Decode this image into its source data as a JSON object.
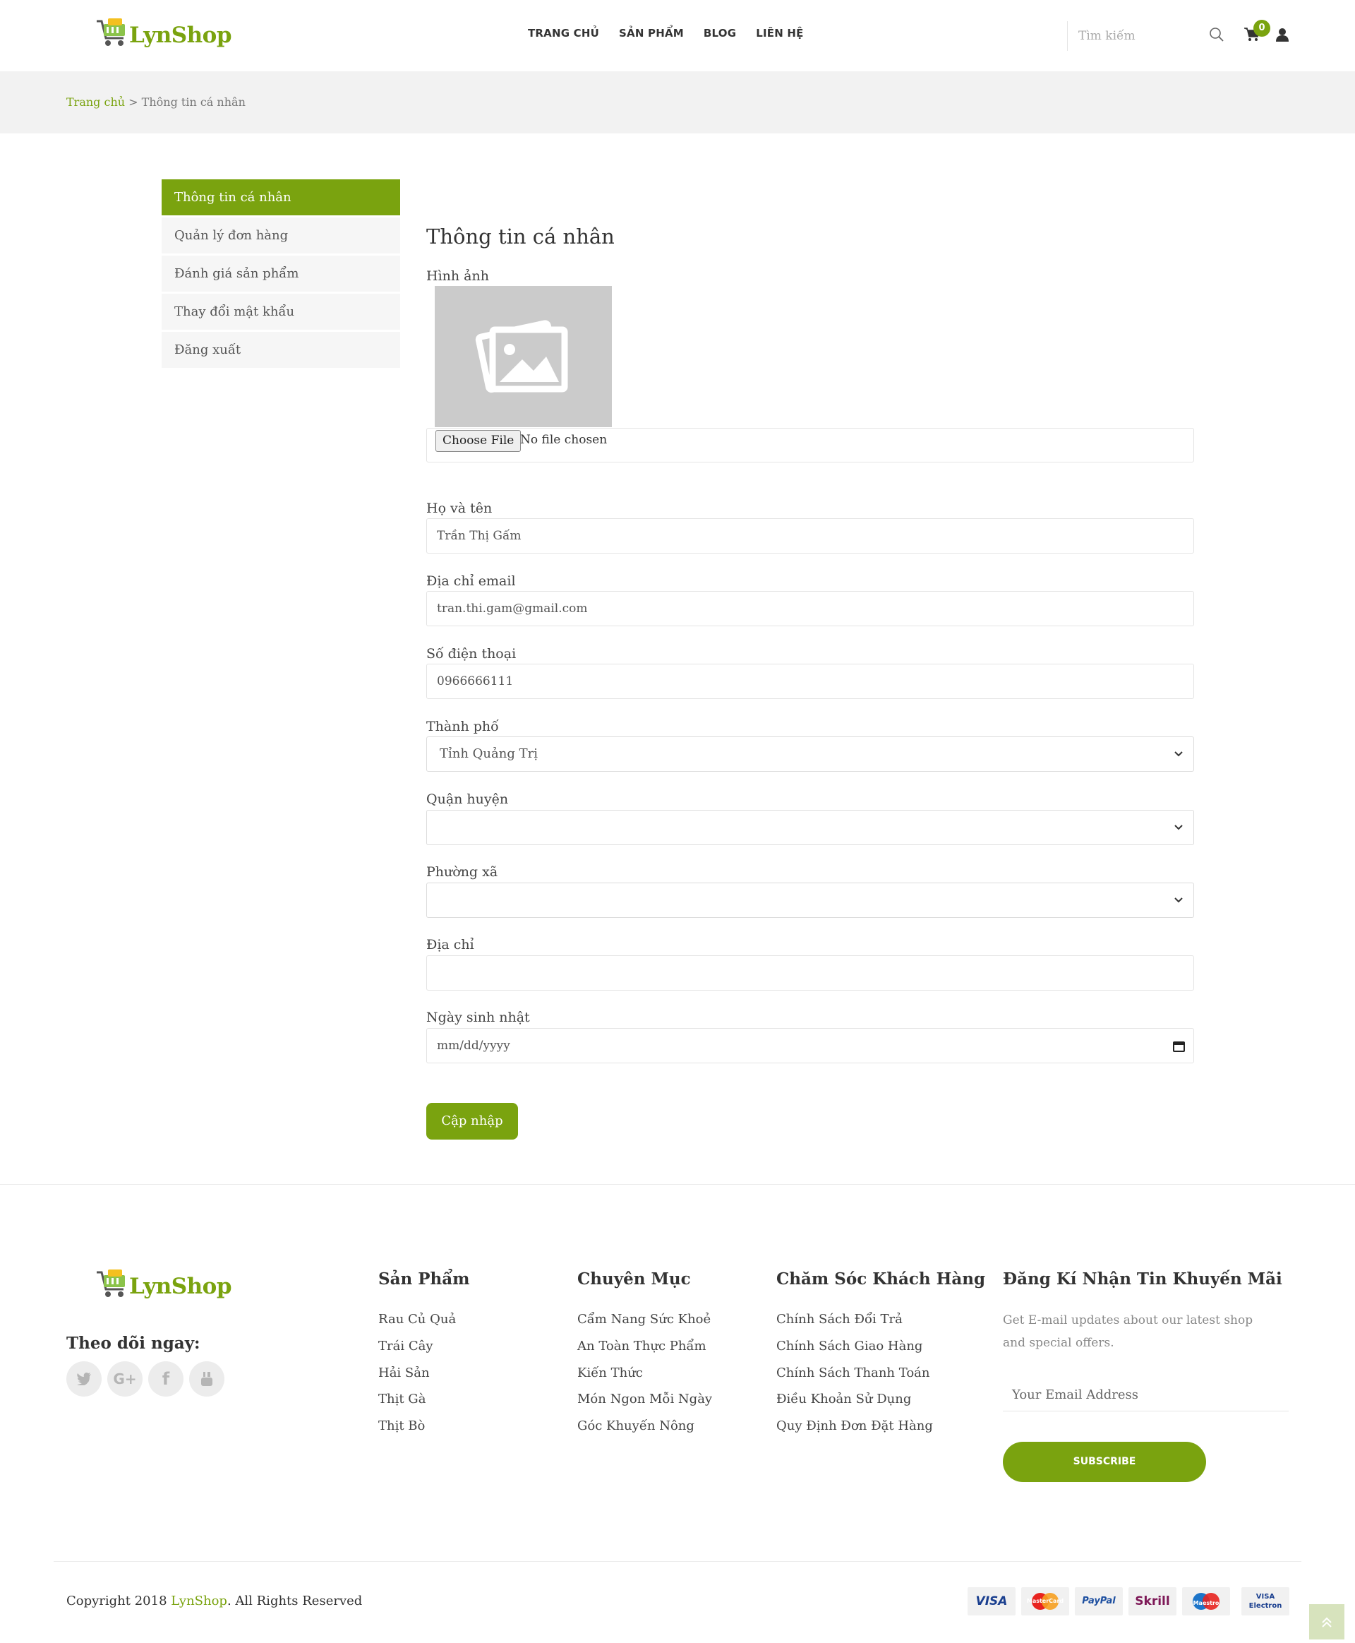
{
  "brand": {
    "name": "LynShop",
    "color": "#7aa30f"
  },
  "header": {
    "nav": [
      "TRANG CHỦ",
      "SẢN PHẨM",
      "BLOG",
      "LIÊN HỆ"
    ],
    "search_placeholder": "Tìm kiếm",
    "cart_count": "0"
  },
  "breadcrumb": {
    "home": "Trang chủ",
    "separator": ">",
    "current": "Thông tin cá nhân"
  },
  "sidebar": {
    "items": [
      {
        "label": "Thông tin cá nhân",
        "active": true
      },
      {
        "label": "Quản lý đơn hàng",
        "active": false
      },
      {
        "label": "Đánh giá sản phẩm",
        "active": false
      },
      {
        "label": "Thay đổi mật khẩu",
        "active": false
      },
      {
        "label": "Đăng xuất",
        "active": false
      }
    ]
  },
  "form": {
    "title": "Thông tin cá nhân",
    "image_label": "Hình ảnh",
    "file_button": "Choose File",
    "file_status": "No file chosen",
    "fields": {
      "fullname": {
        "label": "Họ và tên",
        "value": "Trần Thị Gấm"
      },
      "email": {
        "label": "Địa chỉ email",
        "value": "tran.thi.gam@gmail.com"
      },
      "phone": {
        "label": "Số điện thoại",
        "value": "0966666111"
      },
      "city": {
        "label": "Thành phố",
        "value": "Tỉnh Quảng Trị"
      },
      "district": {
        "label": "Quận huyện",
        "value": ""
      },
      "ward": {
        "label": "Phường xã",
        "value": ""
      },
      "address": {
        "label": "Địa chỉ",
        "value": ""
      },
      "birthday": {
        "label": "Ngày sinh nhật",
        "value": "mm/dd/yyyy"
      }
    },
    "submit": "Cập nhập"
  },
  "footer": {
    "follow_label": "Theo dõi ngay:",
    "social_icons": [
      "twitter-icon",
      "google-plus-icon",
      "facebook-icon",
      "youtube-icon"
    ],
    "columns": [
      {
        "title": "Sản Phẩm",
        "links": [
          "Rau Củ Quả",
          "Trái Cây",
          "Hải Sản",
          "Thịt Gà",
          "Thịt Bò"
        ]
      },
      {
        "title": "Chuyên Mục",
        "links": [
          "Cẩm Nang Sức Khoẻ",
          "An Toàn Thực Phẩm",
          "Kiến Thức",
          "Món Ngon Mỗi Ngày",
          "Góc Khuyến Nông"
        ]
      },
      {
        "title": "Chăm Sóc Khách Hàng",
        "links": [
          "Chính Sách Đổi Trả",
          "Chính Sách Giao Hàng",
          "Chính Sách Thanh Toán",
          "Điều Khoản Sử Dụng",
          "Quy Định Đơn Đặt Hàng"
        ]
      }
    ],
    "newsletter": {
      "title": "Đăng Kí Nhận Tin Khuyến Mãi",
      "text": "Get E-mail updates about our latest shop and special offers.",
      "placeholder": "Your Email Address",
      "button": "SUBSCRIBE"
    },
    "copyright_prefix": "Copyright 2018 ",
    "copyright_brand": "LynShop",
    "copyright_suffix": ". All Rights Reserved",
    "payments": [
      "VISA",
      "MasterCard",
      "PayPal",
      "Skrill",
      "Maestro",
      "VISA Electron"
    ]
  }
}
